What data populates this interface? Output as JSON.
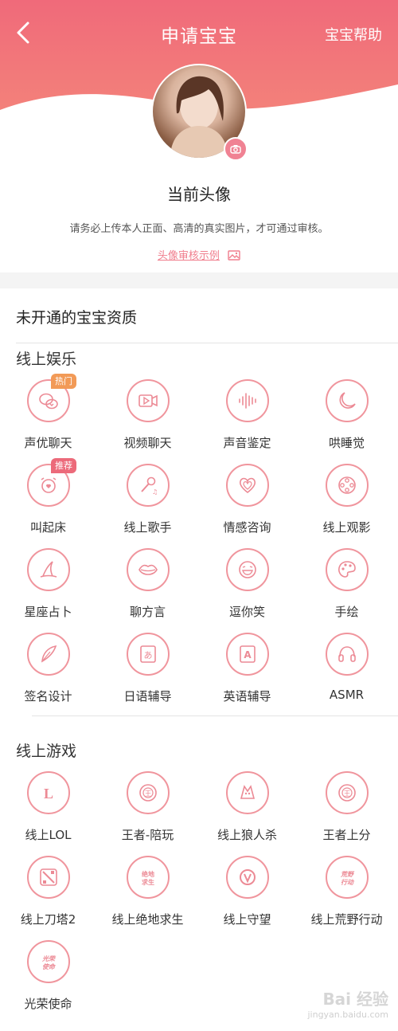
{
  "header": {
    "title": "申请宝宝",
    "help_label": "宝宝帮助"
  },
  "profile": {
    "current_avatar_label": "当前头像",
    "notice": "请务必上传本人正面、高清的真实图片，才可通过审核。",
    "example_link": "头像审核示例"
  },
  "qualifications": {
    "section_title": "未开通的宝宝资质",
    "entertainment": {
      "title": "线上娱乐",
      "items": [
        {
          "label": "声优聊天",
          "icon": "chat-bubbles-icon",
          "tag": "热门"
        },
        {
          "label": "视频聊天",
          "icon": "video-play-icon",
          "tag": ""
        },
        {
          "label": "声音鉴定",
          "icon": "sound-wave-icon",
          "tag": ""
        },
        {
          "label": "哄睡觉",
          "icon": "moon-icon",
          "tag": ""
        },
        {
          "label": "叫起床",
          "icon": "alarm-clock-icon",
          "tag": "推荐"
        },
        {
          "label": "线上歌手",
          "icon": "microphone-icon",
          "tag": ""
        },
        {
          "label": "情感咨询",
          "icon": "heart-icon",
          "tag": ""
        },
        {
          "label": "线上观影",
          "icon": "film-reel-icon",
          "tag": ""
        },
        {
          "label": "星座占卜",
          "icon": "witch-hat-icon",
          "tag": ""
        },
        {
          "label": "聊方言",
          "icon": "lips-icon",
          "tag": ""
        },
        {
          "label": "逗你笑",
          "icon": "laugh-face-icon",
          "tag": ""
        },
        {
          "label": "手绘",
          "icon": "palette-icon",
          "tag": ""
        },
        {
          "label": "签名设计",
          "icon": "feather-pen-icon",
          "tag": ""
        },
        {
          "label": "日语辅导",
          "icon": "japanese-book-icon",
          "tag": ""
        },
        {
          "label": "英语辅导",
          "icon": "english-book-icon",
          "tag": ""
        },
        {
          "label": "ASMR",
          "icon": "headphones-icon",
          "tag": ""
        }
      ]
    },
    "games": {
      "title": "线上游戏",
      "items": [
        {
          "label": "线上LOL",
          "icon": "lol-logo-icon",
          "glyph": "L"
        },
        {
          "label": "王者-陪玩",
          "icon": "honor-of-kings-icon",
          "glyph": "王"
        },
        {
          "label": "线上狼人杀",
          "icon": "werewolf-icon",
          "glyph": ""
        },
        {
          "label": "王者上分",
          "icon": "honor-of-kings-rank-icon",
          "glyph": "王"
        },
        {
          "label": "线上刀塔2",
          "icon": "dota2-logo-icon",
          "glyph": ""
        },
        {
          "label": "线上绝地求生",
          "icon": "pubg-logo-icon",
          "glyph": "绝地\n求生"
        },
        {
          "label": "线上守望",
          "icon": "overwatch-logo-icon",
          "glyph": ""
        },
        {
          "label": "线上荒野行动",
          "icon": "knives-out-logo-icon",
          "glyph": "荒野\n行动"
        },
        {
          "label": "光荣使命",
          "icon": "glorious-mission-logo-icon",
          "glyph": "光荣\n使命"
        }
      ]
    }
  },
  "tag_colors": {
    "热门": "#f29a57",
    "推荐": "#ec6a7a"
  },
  "accent_color": "#f0959d",
  "watermark": "Bai 经验\njingyan.baidu.com"
}
